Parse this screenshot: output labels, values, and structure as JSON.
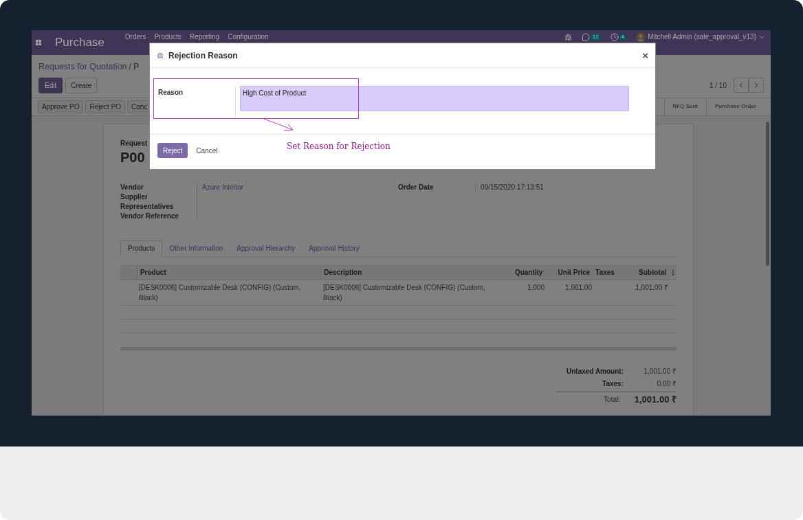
{
  "app": {
    "name": "Purchase",
    "menu": [
      "Orders",
      "Products",
      "Reporting",
      "Configuration"
    ],
    "chat_count": "12",
    "activity_count": "4",
    "user": "Mitchell Admin (sale_approval_v13)"
  },
  "breadcrumb": [
    "Requests for Quotation",
    "P"
  ],
  "breadcrumb_separator": "/",
  "actions": [
    "Edit",
    "Create"
  ],
  "pager": "1 / 10",
  "workflow_buttons": [
    "Approve PO",
    "Reject PO",
    "Canc"
  ],
  "stages": [
    {
      "label": "RFQ Sent",
      "selected": false
    },
    {
      "label": "Purchase Order",
      "selected": false
    }
  ],
  "form": {
    "caption": "Request",
    "name": "P00",
    "left_fields": [
      {
        "label": "Vendor",
        "value": "Azure Interior"
      },
      {
        "label": "Supplier Representatives"
      },
      {
        "label": "Vendor Reference"
      }
    ],
    "right_fields": [
      {
        "label": "Order Date",
        "value": "09/15/2020 17:13:51"
      }
    ],
    "tabs": [
      {
        "label": "Products",
        "selected": true
      },
      {
        "label": "Other Information",
        "selected": false
      },
      {
        "label": "Approval Hierarchy",
        "selected": false
      },
      {
        "label": "Approval History",
        "selected": false
      }
    ],
    "table": {
      "columns": [
        "Product",
        "Description",
        "Quantity",
        "Unit Price",
        "Taxes",
        "Subtotal"
      ],
      "rows": [
        [
          "[DESK0006] Customizable Desk (CONFIG) (Custom, Black)",
          "[DESK0006] Customizable Desk (CONFIG) (Custom, Black)",
          "1.000",
          "1,001.00",
          "",
          "1,001.00 ₹"
        ]
      ]
    },
    "totals": [
      {
        "label": "Untaxed Amount:",
        "value": "1,001.00 ₹"
      },
      {
        "label": "Taxes:",
        "value": "0.00 ₹"
      }
    ],
    "total": {
      "label": "Total:",
      "value": "1,001.00 ₹"
    }
  },
  "dialog": {
    "title": "Rejection Reason",
    "close": "×",
    "field_label": "Reason",
    "field_value": "High Cost of Product",
    "buttons": [
      "Reject",
      "Cancel"
    ],
    "annotation": "Set Reason for Rejection"
  }
}
